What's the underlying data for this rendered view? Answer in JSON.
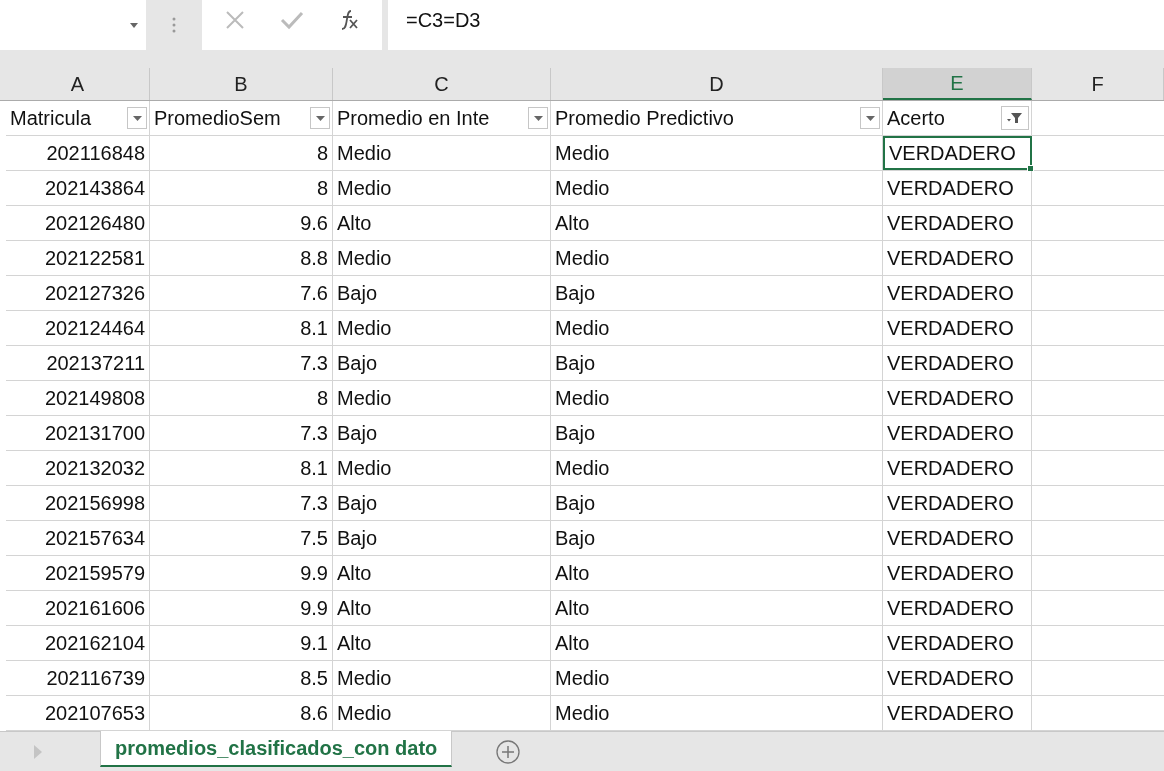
{
  "formula_bar": {
    "formula": "=C3=D3"
  },
  "columns": [
    {
      "label": "A",
      "selected": false
    },
    {
      "label": "B",
      "selected": false
    },
    {
      "label": "C",
      "selected": false
    },
    {
      "label": "D",
      "selected": false
    },
    {
      "label": "E",
      "selected": true
    },
    {
      "label": "F",
      "selected": false
    }
  ],
  "headers": [
    {
      "label": "Matricula",
      "kind": "dropdown"
    },
    {
      "label": "PromedioSem",
      "kind": "dropdown"
    },
    {
      "label": "Promedio en Inte",
      "kind": "dropdown"
    },
    {
      "label": "Promedio Predictivo",
      "kind": "dropdown"
    },
    {
      "label": "Acerto",
      "kind": "filtered"
    }
  ],
  "rows": [
    {
      "cells": [
        "202116848",
        "8",
        "Medio",
        "Medio",
        "VERDADERO"
      ],
      "selected": true
    },
    {
      "cells": [
        "202143864",
        "8",
        "Medio",
        "Medio",
        "VERDADERO"
      ],
      "selected": false
    },
    {
      "cells": [
        "202126480",
        "9.6",
        "Alto",
        "Alto",
        "VERDADERO"
      ],
      "selected": false
    },
    {
      "cells": [
        "202122581",
        "8.8",
        "Medio",
        "Medio",
        "VERDADERO"
      ],
      "selected": false
    },
    {
      "cells": [
        "202127326",
        "7.6",
        "Bajo",
        "Bajo",
        "VERDADERO"
      ],
      "selected": false
    },
    {
      "cells": [
        "202124464",
        "8.1",
        "Medio",
        "Medio",
        "VERDADERO"
      ],
      "selected": false
    },
    {
      "cells": [
        "202137211",
        "7.3",
        "Bajo",
        "Bajo",
        "VERDADERO"
      ],
      "selected": false
    },
    {
      "cells": [
        "202149808",
        "8",
        "Medio",
        "Medio",
        "VERDADERO"
      ],
      "selected": false
    },
    {
      "cells": [
        "202131700",
        "7.3",
        "Bajo",
        "Bajo",
        "VERDADERO"
      ],
      "selected": false
    },
    {
      "cells": [
        "202132032",
        "8.1",
        "Medio",
        "Medio",
        "VERDADERO"
      ],
      "selected": false
    },
    {
      "cells": [
        "202156998",
        "7.3",
        "Bajo",
        "Bajo",
        "VERDADERO"
      ],
      "selected": false
    },
    {
      "cells": [
        "202157634",
        "7.5",
        "Bajo",
        "Bajo",
        "VERDADERO"
      ],
      "selected": false
    },
    {
      "cells": [
        "202159579",
        "9.9",
        "Alto",
        "Alto",
        "VERDADERO"
      ],
      "selected": false
    },
    {
      "cells": [
        "202161606",
        "9.9",
        "Alto",
        "Alto",
        "VERDADERO"
      ],
      "selected": false
    },
    {
      "cells": [
        "202162104",
        "9.1",
        "Alto",
        "Alto",
        "VERDADERO"
      ],
      "selected": false
    },
    {
      "cells": [
        "202116739",
        "8.5",
        "Medio",
        "Medio",
        "VERDADERO"
      ],
      "selected": false
    },
    {
      "cells": [
        "202107653",
        "8.6",
        "Medio",
        "Medio",
        "VERDADERO"
      ],
      "selected": false
    }
  ],
  "sheet_tabs": [
    {
      "label": "promedios_clasificados_con dato",
      "selected": true
    }
  ]
}
